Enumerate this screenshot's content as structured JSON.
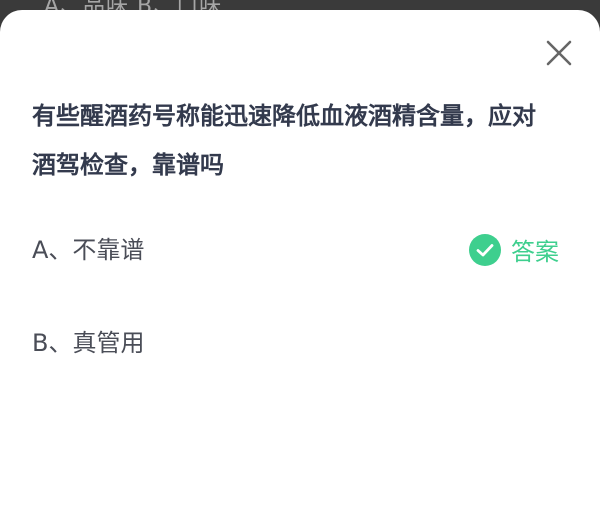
{
  "background": {
    "peek_text": "A、品味   B、口味"
  },
  "quiz": {
    "question": "有些醒酒药号称能迅速降低血液酒精含量，应对酒驾检查，靠谱吗",
    "options": [
      {
        "label": "A、不靠谱",
        "is_answer": true
      },
      {
        "label": "B、真管用",
        "is_answer": false
      }
    ],
    "answer_label": "答案"
  },
  "colors": {
    "question_text": "#333a4d",
    "option_text": "#4a4d57",
    "accent_green": "#3ecf8e",
    "close_icon": "#666666"
  },
  "icons": {
    "close": "close-icon",
    "answer": "check-circle-icon"
  }
}
